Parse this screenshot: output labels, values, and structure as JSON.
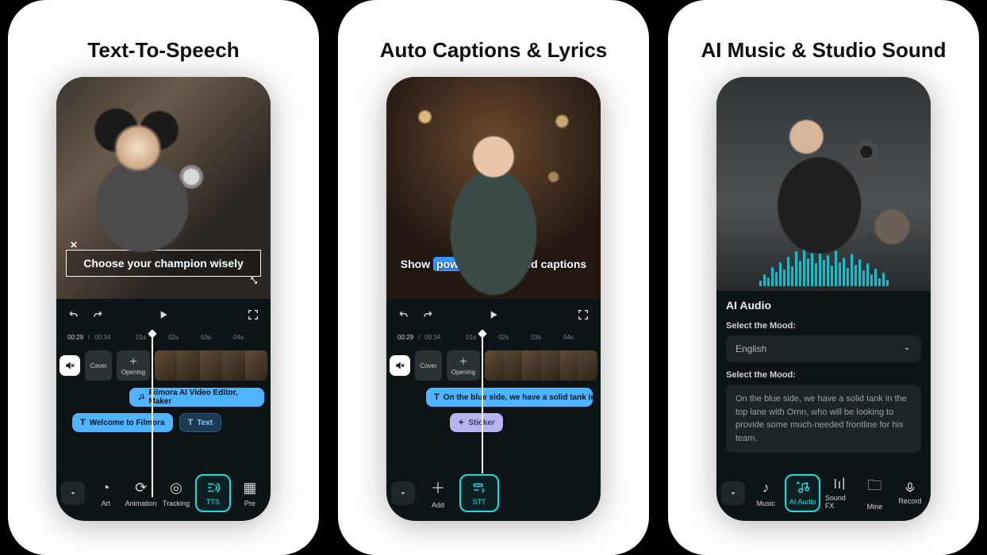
{
  "panels": {
    "a": {
      "title": "Text-To-Speech",
      "caption_text": "Choose your champion wisely",
      "time": {
        "now": "00:29",
        "total": "00:34",
        "ticks": [
          "01s",
          "02s",
          "03s",
          "04s"
        ]
      },
      "segments": {
        "cover": "Cover",
        "opening": "Opening"
      },
      "chips": {
        "line1": "Filmora AI Video Editor, Maker",
        "line2a": "Welcome to Filmora",
        "line2b": "Text"
      },
      "toolbar": [
        "Art",
        "Animation",
        "Tracking",
        "TTS",
        "Pre"
      ],
      "active_tool": "TTS"
    },
    "b": {
      "title": "Auto Captions & Lyrics",
      "caption_pre": "Show ",
      "caption_hl": "powerful",
      "caption_post": " animated captions",
      "time": {
        "now": "00:29",
        "total": "00:34",
        "ticks": [
          "01s",
          "02s",
          "03s",
          "04s"
        ]
      },
      "segments": {
        "cover": "Cover",
        "opening": "Opening"
      },
      "chips": {
        "long": "On the blue side,  we have a solid tank in the top l",
        "sticker": "Sticker"
      },
      "toolbar": [
        "Add",
        "STT"
      ],
      "active_tool": "STT"
    },
    "c": {
      "title": "AI Music & Studio Sound",
      "ai_title": "AI Audio",
      "mood_label": "Select the Mood:",
      "mood_value": "English",
      "text_value": "On the blue side, we have a solid tank in the top lane with Ornn, who will be looking to provide some much-needed frontline for his team.",
      "toolbar": [
        "Music",
        "AI Audio",
        "Sound FX",
        "Mine",
        "Record"
      ],
      "active_tool": "AI Audio"
    }
  }
}
